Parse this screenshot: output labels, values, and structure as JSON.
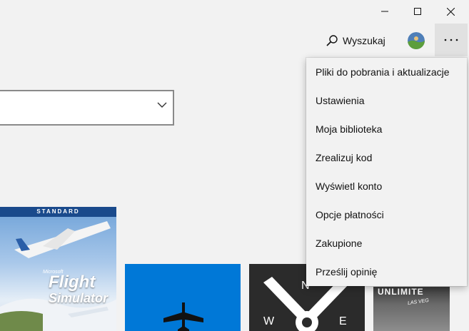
{
  "window": {
    "controls": [
      {
        "name": "minimize-icon"
      },
      {
        "name": "maximize-icon"
      },
      {
        "name": "close-icon"
      }
    ]
  },
  "header": {
    "search_label": "Wyszukaj",
    "search_icon": "search-icon",
    "more_icon": "more-horizontal-icon"
  },
  "menu": {
    "items": [
      {
        "label": "Pliki do pobrania i aktualizacje"
      },
      {
        "label": "Ustawienia"
      },
      {
        "label": "Moja biblioteka"
      },
      {
        "label": "Zrealizuj kod"
      },
      {
        "label": "Wyświetl konto"
      },
      {
        "label": "Opcje płatności"
      },
      {
        "label": "Zakupione"
      },
      {
        "label": "Prześlij opinię"
      }
    ]
  },
  "tiles": {
    "flight_banner": "STANDARD",
    "flight_title_1": "Flight",
    "flight_title_2": "Simulator",
    "flight_publisher": "Microsoft",
    "compass_n": "N",
    "compass_w": "W",
    "compass_e": "E",
    "vegas_title": "UNLIMITE",
    "vegas_sub": "LAS VEG"
  },
  "colors": {
    "accent_tile": "#0078d7",
    "menu_bg": "#f2f2f2",
    "hover_bg": "#e1e1e1"
  }
}
